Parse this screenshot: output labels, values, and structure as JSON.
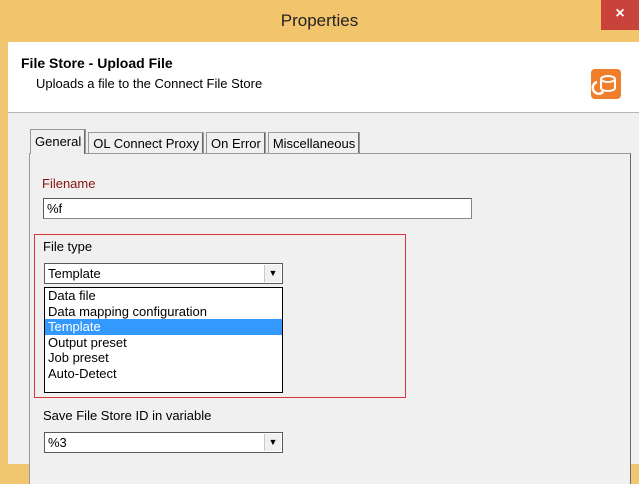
{
  "window": {
    "title": "Properties",
    "close_label": "×"
  },
  "header": {
    "title": "File Store - Upload File",
    "description": "Uploads a file to the Connect File Store",
    "icon": "file-store-icon",
    "icon_color": "#f07d2a"
  },
  "tabs": [
    {
      "label": "General",
      "active": true
    },
    {
      "label": "OL Connect Proxy",
      "active": false
    },
    {
      "label": "On Error",
      "active": false
    },
    {
      "label": "Miscellaneous",
      "active": false
    }
  ],
  "filename": {
    "label": "Filename",
    "value": "%f"
  },
  "file_type": {
    "label": "File type",
    "value": "Template",
    "options": [
      {
        "label": "Data file",
        "selected": false
      },
      {
        "label": "Data mapping configuration",
        "selected": false
      },
      {
        "label": "Template",
        "selected": true
      },
      {
        "label": "Output preset",
        "selected": false
      },
      {
        "label": "Job preset",
        "selected": false
      },
      {
        "label": "Auto-Detect",
        "selected": false
      }
    ]
  },
  "save_id": {
    "label": "Save File Store ID in variable",
    "value": "%3"
  },
  "colors": {
    "titlebar": "#f2c56d",
    "selection": "#3399ff",
    "highlight_border": "#d9343a",
    "required_label": "#8b1010"
  }
}
